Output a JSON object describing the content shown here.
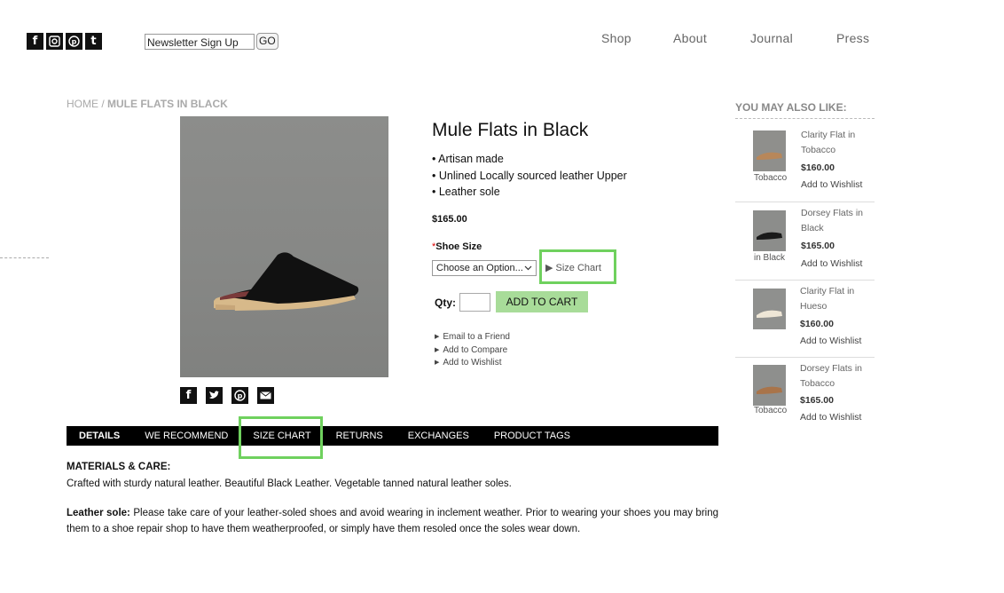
{
  "header": {
    "social_icons": [
      "facebook-icon",
      "instagram-icon",
      "pinterest-icon",
      "tumblr-icon"
    ],
    "newsletter_placeholder": "Newsletter Sign Up",
    "newsletter_go": "GO",
    "nav": [
      "Shop",
      "About",
      "Journal",
      "Press"
    ]
  },
  "breadcrumb": {
    "home": "HOME",
    "sep": " / ",
    "current": "MULE FLATS IN BLACK"
  },
  "product": {
    "title": "Mule Flats in Black",
    "bullets": [
      "• Artisan made",
      "• Unlined Locally sourced leather Upper",
      "• Leather sole"
    ],
    "price": "$165.00",
    "size_required": "*",
    "size_label": "Shoe Size",
    "size_select": "Choose an Option...",
    "size_chart_link": "▶ Size Chart",
    "qty_label": "Qty:",
    "qty_value": "",
    "add_to_cart": "ADD TO CART",
    "links": [
      "Email to a Friend",
      "Add to Compare",
      "Add to Wishlist"
    ],
    "share_icons": [
      "facebook-icon",
      "twitter-icon",
      "pinterest-icon",
      "email-icon"
    ]
  },
  "tabs": [
    "DETAILS",
    "WE RECOMMEND",
    "SIZE CHART",
    "RETURNS",
    "EXCHANGES",
    "PRODUCT TAGS"
  ],
  "details": {
    "materials_title": "MATERIALS & CARE:",
    "materials_body": "Crafted with sturdy natural leather. Beautiful Black Leather. Vegetable tanned natural leather soles.",
    "sole_title": "Leather sole:",
    "sole_body": " Please take care of your leather-soled shoes and avoid wearing in inclement weather. Prior to wearing your shoes you may bring them to a shoe repair shop to have them weatherproofed, or simply have them resoled once the soles wear down."
  },
  "recommend": {
    "title": "YOU MAY ALSO LIKE:",
    "items": [
      {
        "name": "Clarity Flat in Tobacco",
        "price": "$160.00",
        "wishlist": "Add to Wishlist",
        "caption": "Tobacco"
      },
      {
        "name": "Dorsey Flats in Black",
        "price": "$165.00",
        "wishlist": "Add to Wishlist",
        "caption": "in Black"
      },
      {
        "name": "Clarity Flat in Hueso",
        "price": "$160.00",
        "wishlist": "Add to Wishlist",
        "caption": ""
      },
      {
        "name": "Dorsey Flats in Tobacco",
        "price": "$165.00",
        "wishlist": "Add to Wishlist",
        "caption": "Tobacco"
      }
    ]
  },
  "colors": {
    "highlight": "#6fd15e",
    "cart_button": "#a8dc99",
    "tab_bar": "#000000"
  }
}
